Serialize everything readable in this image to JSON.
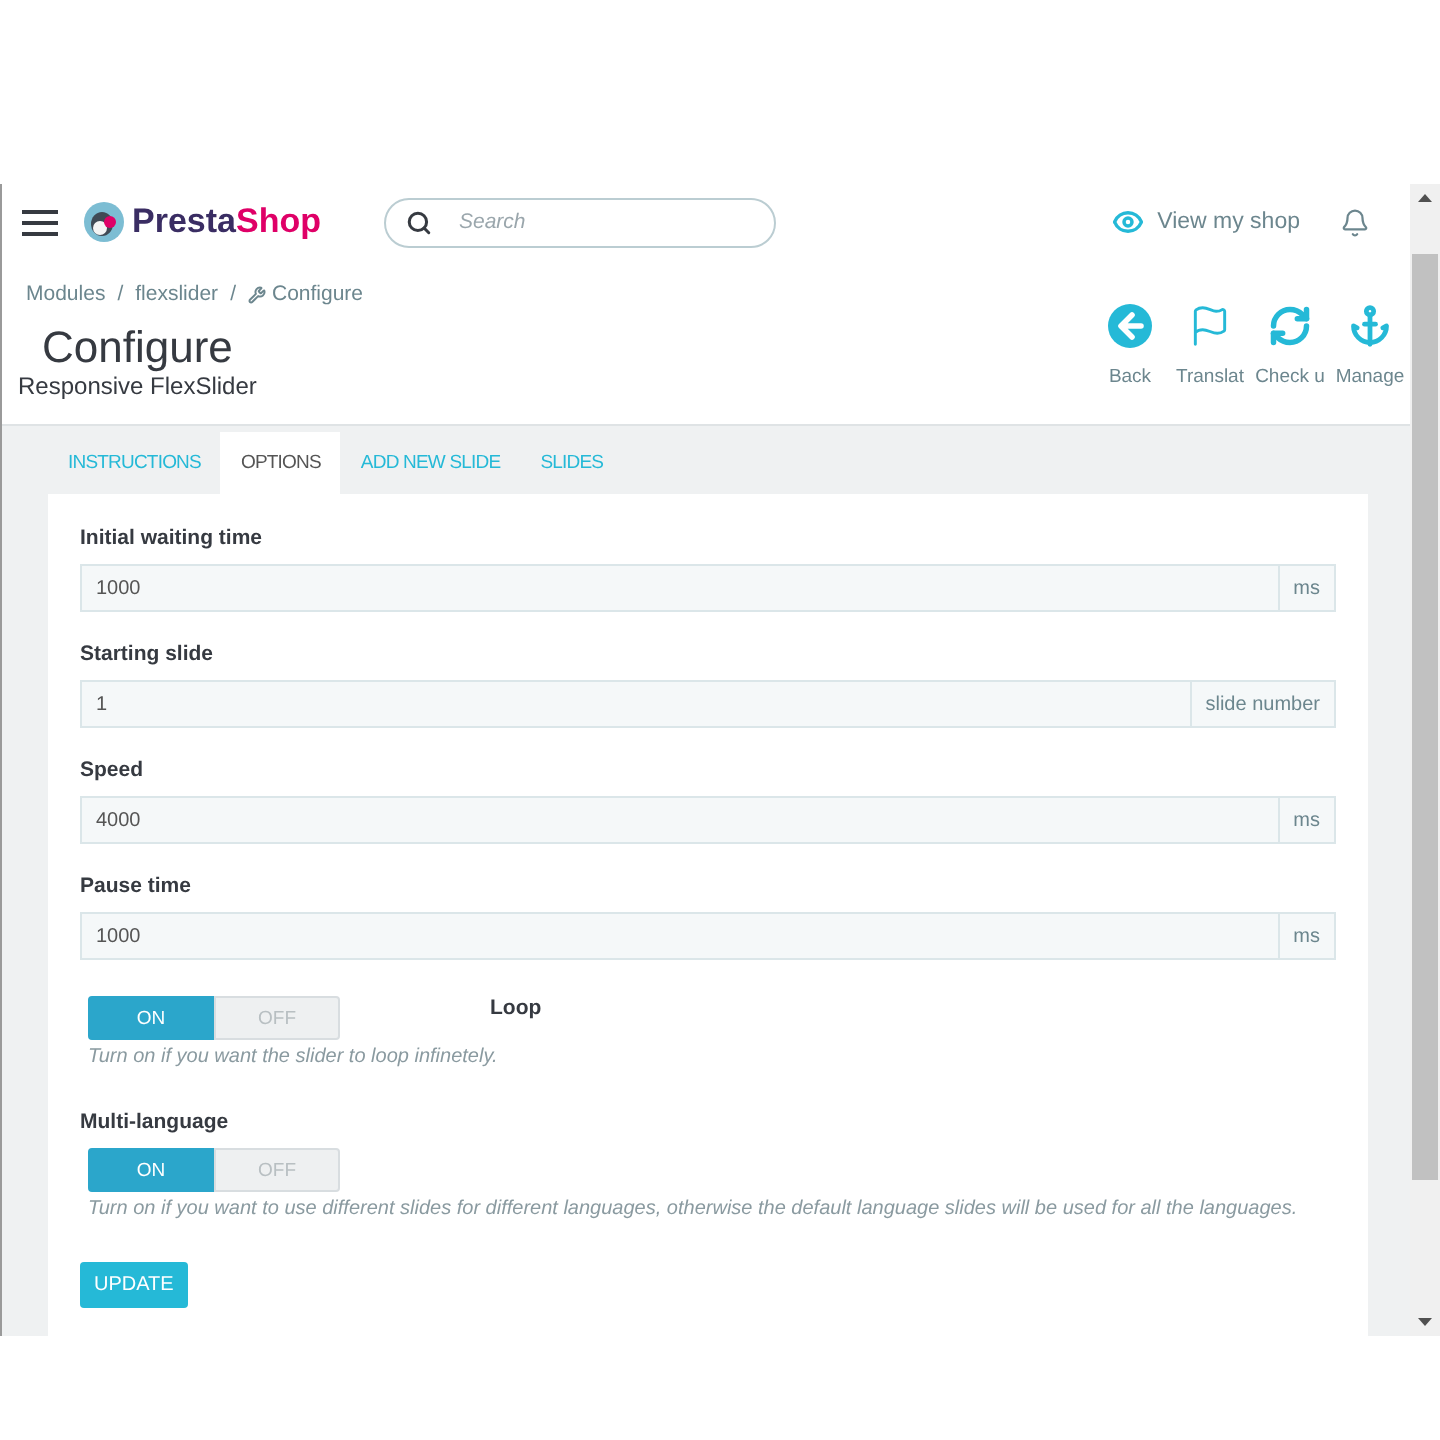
{
  "header": {
    "logo": {
      "first": "Presta",
      "second": "Shop"
    },
    "search": {
      "placeholder": "Search"
    },
    "view_shop": "View my shop"
  },
  "breadcrumb": [
    {
      "label": "Modules",
      "separator": "/"
    },
    {
      "label": "flexslider",
      "separator": "/"
    },
    {
      "label": "Configure"
    }
  ],
  "page": {
    "title": "Configure",
    "subtitle": "Responsive FlexSlider"
  },
  "toolbar": [
    {
      "label": "Back"
    },
    {
      "label": "Translat"
    },
    {
      "label": "Check u"
    },
    {
      "label": "Manage"
    }
  ],
  "tabs": [
    {
      "label": "INSTRUCTIONS",
      "selected": false
    },
    {
      "label": "OPTIONS",
      "selected": true
    },
    {
      "label": "ADD NEW SLIDE",
      "selected": false
    },
    {
      "label": "SLIDES",
      "selected": false
    }
  ],
  "form": {
    "fields": [
      {
        "kind": "input",
        "label": "Initial waiting time",
        "value": "1000",
        "addon": "ms"
      },
      {
        "kind": "input",
        "label": "Starting slide",
        "value": "1",
        "addon": "slide number"
      },
      {
        "kind": "input",
        "label": "Speed",
        "value": "4000",
        "addon": "ms"
      },
      {
        "kind": "input",
        "label": "Pause time",
        "value": "1000",
        "addon": "ms"
      },
      {
        "kind": "switch",
        "label": "Loop",
        "label_beside": true,
        "on": true,
        "on_label": "ON",
        "off_label": "OFF",
        "help": "Turn on if you want the slider to loop infinetely."
      },
      {
        "kind": "switch",
        "label": "Multi-language",
        "label_beside": false,
        "on": true,
        "on_label": "ON",
        "off_label": "OFF",
        "help": "Turn on if you want to use different slides for different languages, otherwise the default language slides will be used for all the languages."
      }
    ],
    "submit": "UPDATE"
  }
}
